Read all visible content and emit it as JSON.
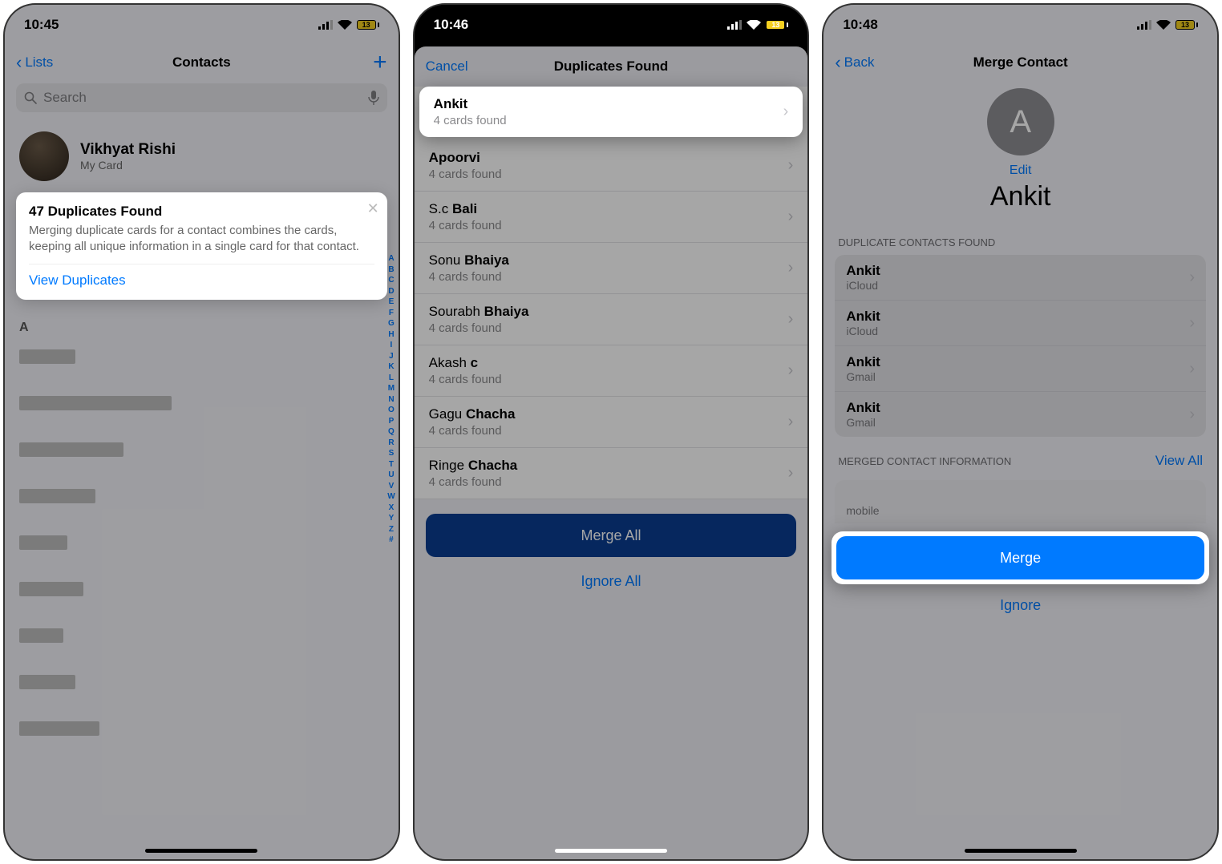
{
  "screens": [
    {
      "status": {
        "time": "10:45",
        "battery": "13"
      },
      "nav": {
        "back": "Lists",
        "title": "Contacts"
      },
      "search": {
        "placeholder": "Search"
      },
      "mycard": {
        "name": "Vikhyat Rishi",
        "sub": "My Card"
      },
      "popup": {
        "title": "47 Duplicates Found",
        "body": "Merging duplicate cards for a contact combines the cards, keeping all unique information in a single card for that contact.",
        "action": "View Duplicates"
      },
      "section_letter": "A",
      "index_rail": "A\nB\nC\nD\nE\nF\nG\nH\nI\nJ\nK\nL\nM\nN\nO\nP\nQ\nR\nS\nT\nU\nV\nW\nX\nY\nZ\n#"
    },
    {
      "status": {
        "time": "10:46",
        "battery": "13"
      },
      "nav": {
        "cancel": "Cancel",
        "title": "Duplicates Found"
      },
      "items": [
        {
          "first": "",
          "bold": "Ankit",
          "sub": "4 cards found",
          "highlight": true
        },
        {
          "first": "",
          "bold": "Apoorvi",
          "sub": "4 cards found"
        },
        {
          "first": "S.c ",
          "bold": "Bali",
          "sub": "4 cards found"
        },
        {
          "first": "Sonu ",
          "bold": "Bhaiya",
          "sub": "4 cards found"
        },
        {
          "first": "Sourabh ",
          "bold": "Bhaiya",
          "sub": "4 cards found"
        },
        {
          "first": "Akash ",
          "bold": "c",
          "sub": "4 cards found"
        },
        {
          "first": "Gagu ",
          "bold": "Chacha",
          "sub": "4 cards found"
        },
        {
          "first": "Ringe ",
          "bold": "Chacha",
          "sub": "4 cards found"
        }
      ],
      "merge_all": "Merge All",
      "ignore_all": "Ignore All"
    },
    {
      "status": {
        "time": "10:48",
        "battery": "13"
      },
      "nav": {
        "back": "Back",
        "title": "Merge Contact"
      },
      "avatar_letter": "A",
      "edit": "Edit",
      "name": "Ankit",
      "dup_header": "DUPLICATE CONTACTS FOUND",
      "dups": [
        {
          "name": "Ankit",
          "source": "iCloud"
        },
        {
          "name": "Ankit",
          "source": "iCloud"
        },
        {
          "name": "Ankit",
          "source": "Gmail"
        },
        {
          "name": "Ankit",
          "source": "Gmail"
        }
      ],
      "merged_header": "MERGED CONTACT INFORMATION",
      "view_all": "View All",
      "mobile_label": "mobile",
      "merge": "Merge",
      "ignore": "Ignore"
    }
  ]
}
